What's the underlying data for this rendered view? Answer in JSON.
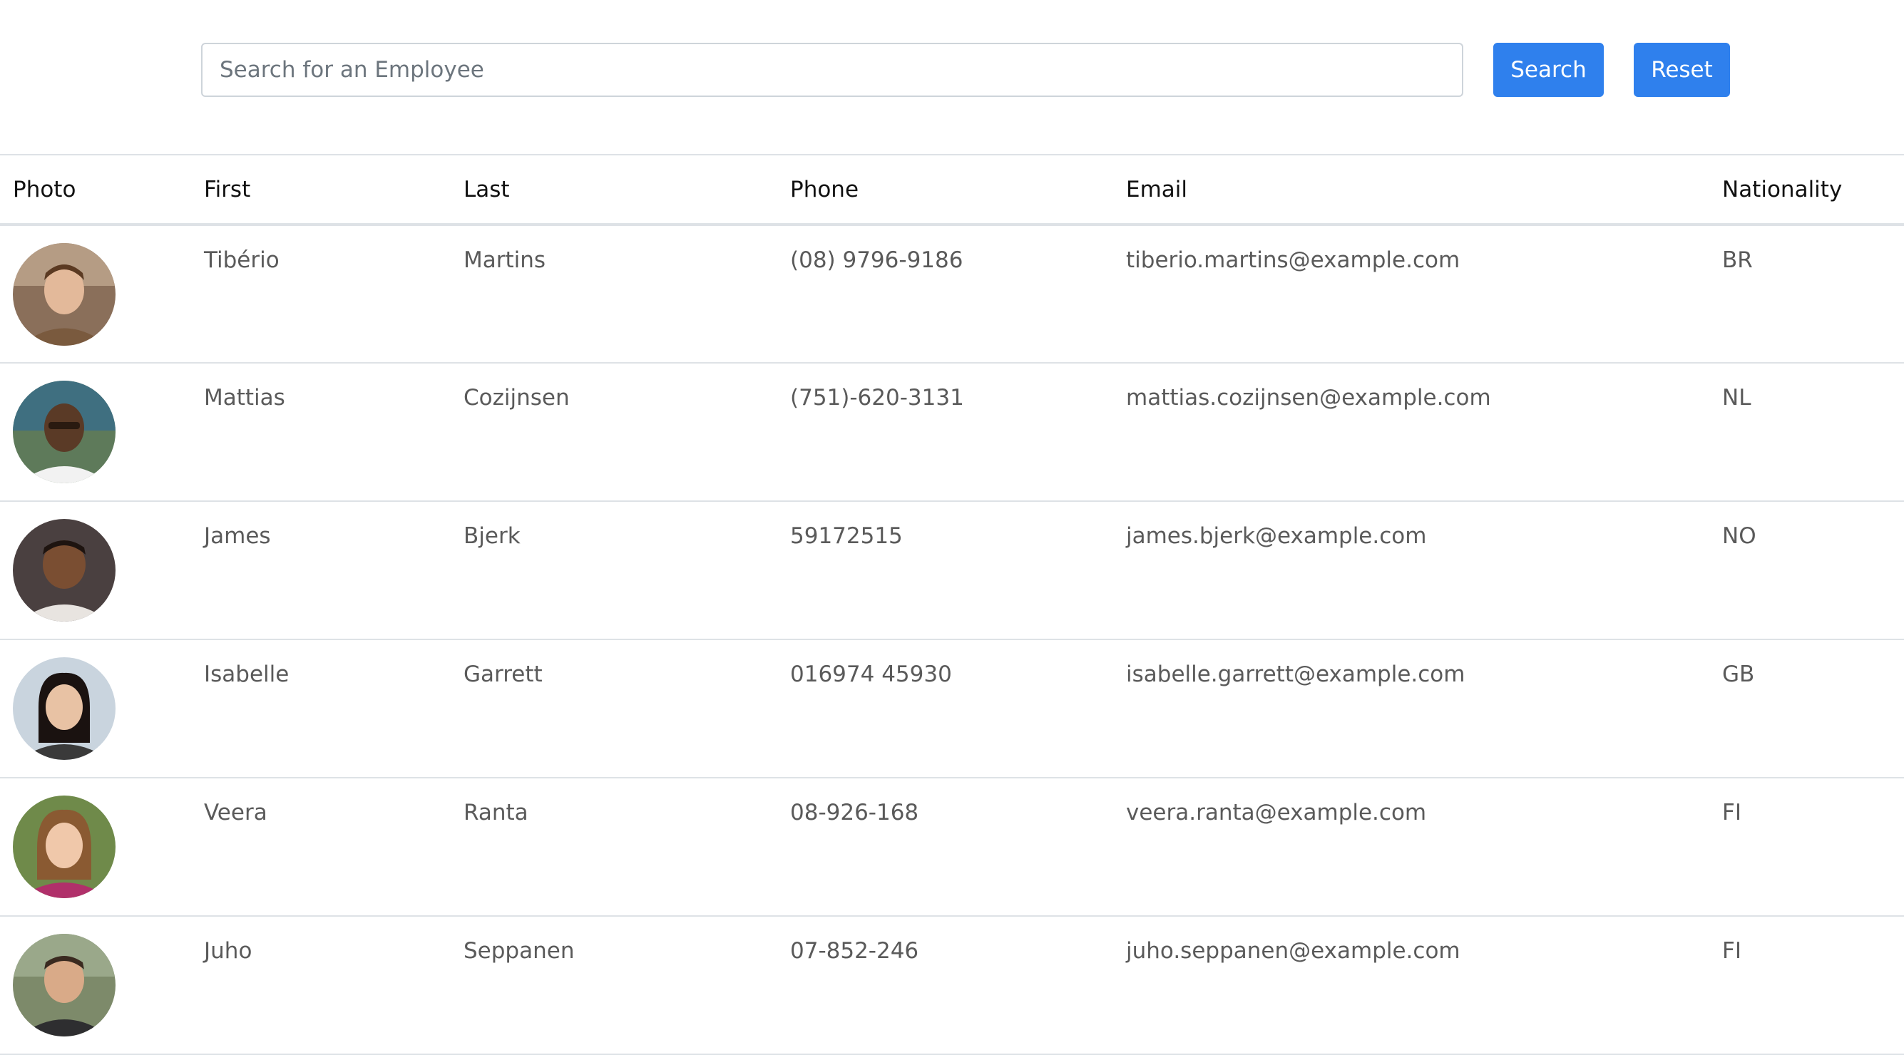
{
  "search": {
    "placeholder": "Search for an Employee",
    "value": "",
    "search_label": "Search",
    "reset_label": "Reset",
    "button_color": "#2f80ed"
  },
  "table": {
    "headers": {
      "photo": "Photo",
      "first": "First",
      "last": "Last",
      "phone": "Phone",
      "email": "Email",
      "nationality": "Nationality"
    },
    "rows": [
      {
        "first": "Tibério",
        "last": "Martins",
        "phone": "(08) 9796-9186",
        "email": "tiberio.martins@example.com",
        "nationality": "BR",
        "photo": "employee-photo"
      },
      {
        "first": "Mattias",
        "last": "Cozijnsen",
        "phone": "(751)-620-3131",
        "email": "mattias.cozijnsen@example.com",
        "nationality": "NL",
        "photo": "employee-photo"
      },
      {
        "first": "James",
        "last": "Bjerk",
        "phone": "59172515",
        "email": "james.bjerk@example.com",
        "nationality": "NO",
        "photo": "employee-photo"
      },
      {
        "first": "Isabelle",
        "last": "Garrett",
        "phone": "016974 45930",
        "email": "isabelle.garrett@example.com",
        "nationality": "GB",
        "photo": "employee-photo"
      },
      {
        "first": "Veera",
        "last": "Ranta",
        "phone": "08-926-168",
        "email": "veera.ranta@example.com",
        "nationality": "FI",
        "photo": "employee-photo"
      },
      {
        "first": "Juho",
        "last": "Seppanen",
        "phone": "07-852-246",
        "email": "juho.seppanen@example.com",
        "nationality": "FI",
        "photo": "employee-photo"
      }
    ]
  }
}
